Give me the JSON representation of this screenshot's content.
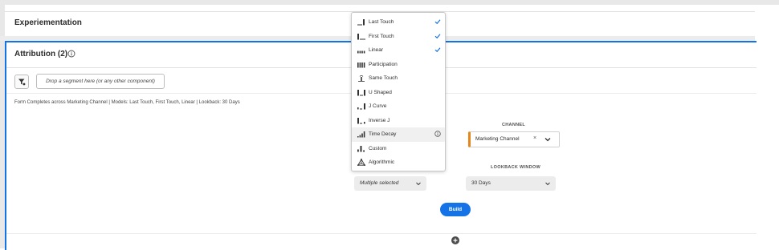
{
  "colors": {
    "accent": "#1473e6",
    "channel_marker": "#e68619",
    "check": "#1473e6"
  },
  "experimentation": {
    "title": "Experiementation"
  },
  "attribution": {
    "title": "Attribution (2)",
    "info_icon": "info-circle-icon",
    "segment_placeholder": "Drop a segment here (or any other component)",
    "summary": "Form Completes across Marketing Channel | Models: Last Touch, First Touch, Linear | Lookback: 30 Days",
    "channel": {
      "label": "CHANNEL",
      "value": "Marketing Channel",
      "clear": "×"
    },
    "lookback": {
      "label": "LOOKBACK WINDOW",
      "value": "30 Days"
    },
    "models_select": {
      "value": "Multiple selected"
    },
    "build_label": "Build"
  },
  "model_menu": {
    "items": [
      {
        "label": "Last Touch",
        "icon": "last-touch-icon",
        "checked": true
      },
      {
        "label": "First Touch",
        "icon": "first-touch-icon",
        "checked": true
      },
      {
        "label": "Linear",
        "icon": "linear-icon",
        "checked": true
      },
      {
        "label": "Participation",
        "icon": "participation-icon",
        "checked": false
      },
      {
        "label": "Same Touch",
        "icon": "same-touch-icon",
        "checked": false
      },
      {
        "label": "U Shaped",
        "icon": "u-shaped-icon",
        "checked": false
      },
      {
        "label": "J Curve",
        "icon": "j-curve-icon",
        "checked": false
      },
      {
        "label": "Inverse J",
        "icon": "inverse-j-icon",
        "checked": false
      },
      {
        "label": "Time Decay",
        "icon": "time-decay-icon",
        "checked": false,
        "info": true,
        "hovered": true
      },
      {
        "label": "Custom",
        "icon": "custom-icon",
        "checked": false
      },
      {
        "label": "Algorithmic",
        "icon": "algorithmic-icon",
        "checked": false
      }
    ]
  }
}
